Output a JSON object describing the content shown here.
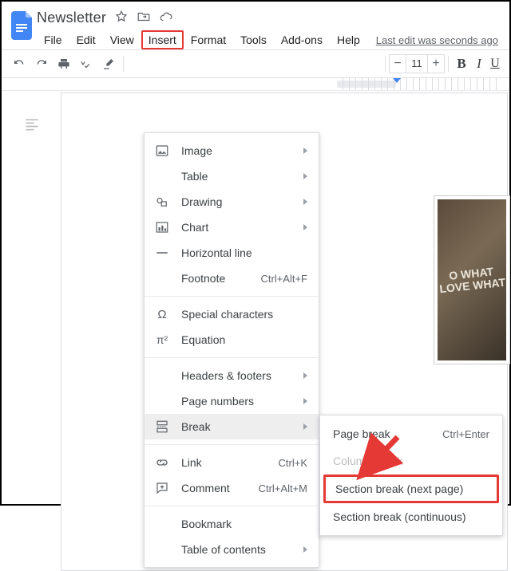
{
  "doc": {
    "title": "Newsletter"
  },
  "menubar": {
    "items": [
      "File",
      "Edit",
      "View",
      "Insert",
      "Format",
      "Tools",
      "Add-ons",
      "Help"
    ],
    "last_edit": "Last edit was seconds ago"
  },
  "toolbar": {
    "undo": "Undo",
    "redo": "Redo",
    "print": "Print",
    "spell": "Spelling",
    "paint": "Paint format",
    "font_size": "11",
    "bold": "B",
    "italic": "I",
    "underline": "U"
  },
  "insert_menu": {
    "image": "Image",
    "table": "Table",
    "drawing": "Drawing",
    "chart": "Chart",
    "hline": "Horizontal line",
    "footnote": "Footnote",
    "footnote_sc": "Ctrl+Alt+F",
    "special": "Special characters",
    "equation": "Equation",
    "headers": "Headers & footers",
    "pagenums": "Page numbers",
    "break": "Break",
    "link": "Link",
    "link_sc": "Ctrl+K",
    "comment": "Comment",
    "comment_sc": "Ctrl+Alt+M",
    "bookmark": "Bookmark",
    "toc": "Table of contents"
  },
  "break_menu": {
    "page": "Page break",
    "page_sc": "Ctrl+Enter",
    "column": "Column break",
    "section_next": "Section break (next page)",
    "section_cont": "Section break (continuous)"
  },
  "doc_image_text": "O WHAT LOVE WHAT"
}
